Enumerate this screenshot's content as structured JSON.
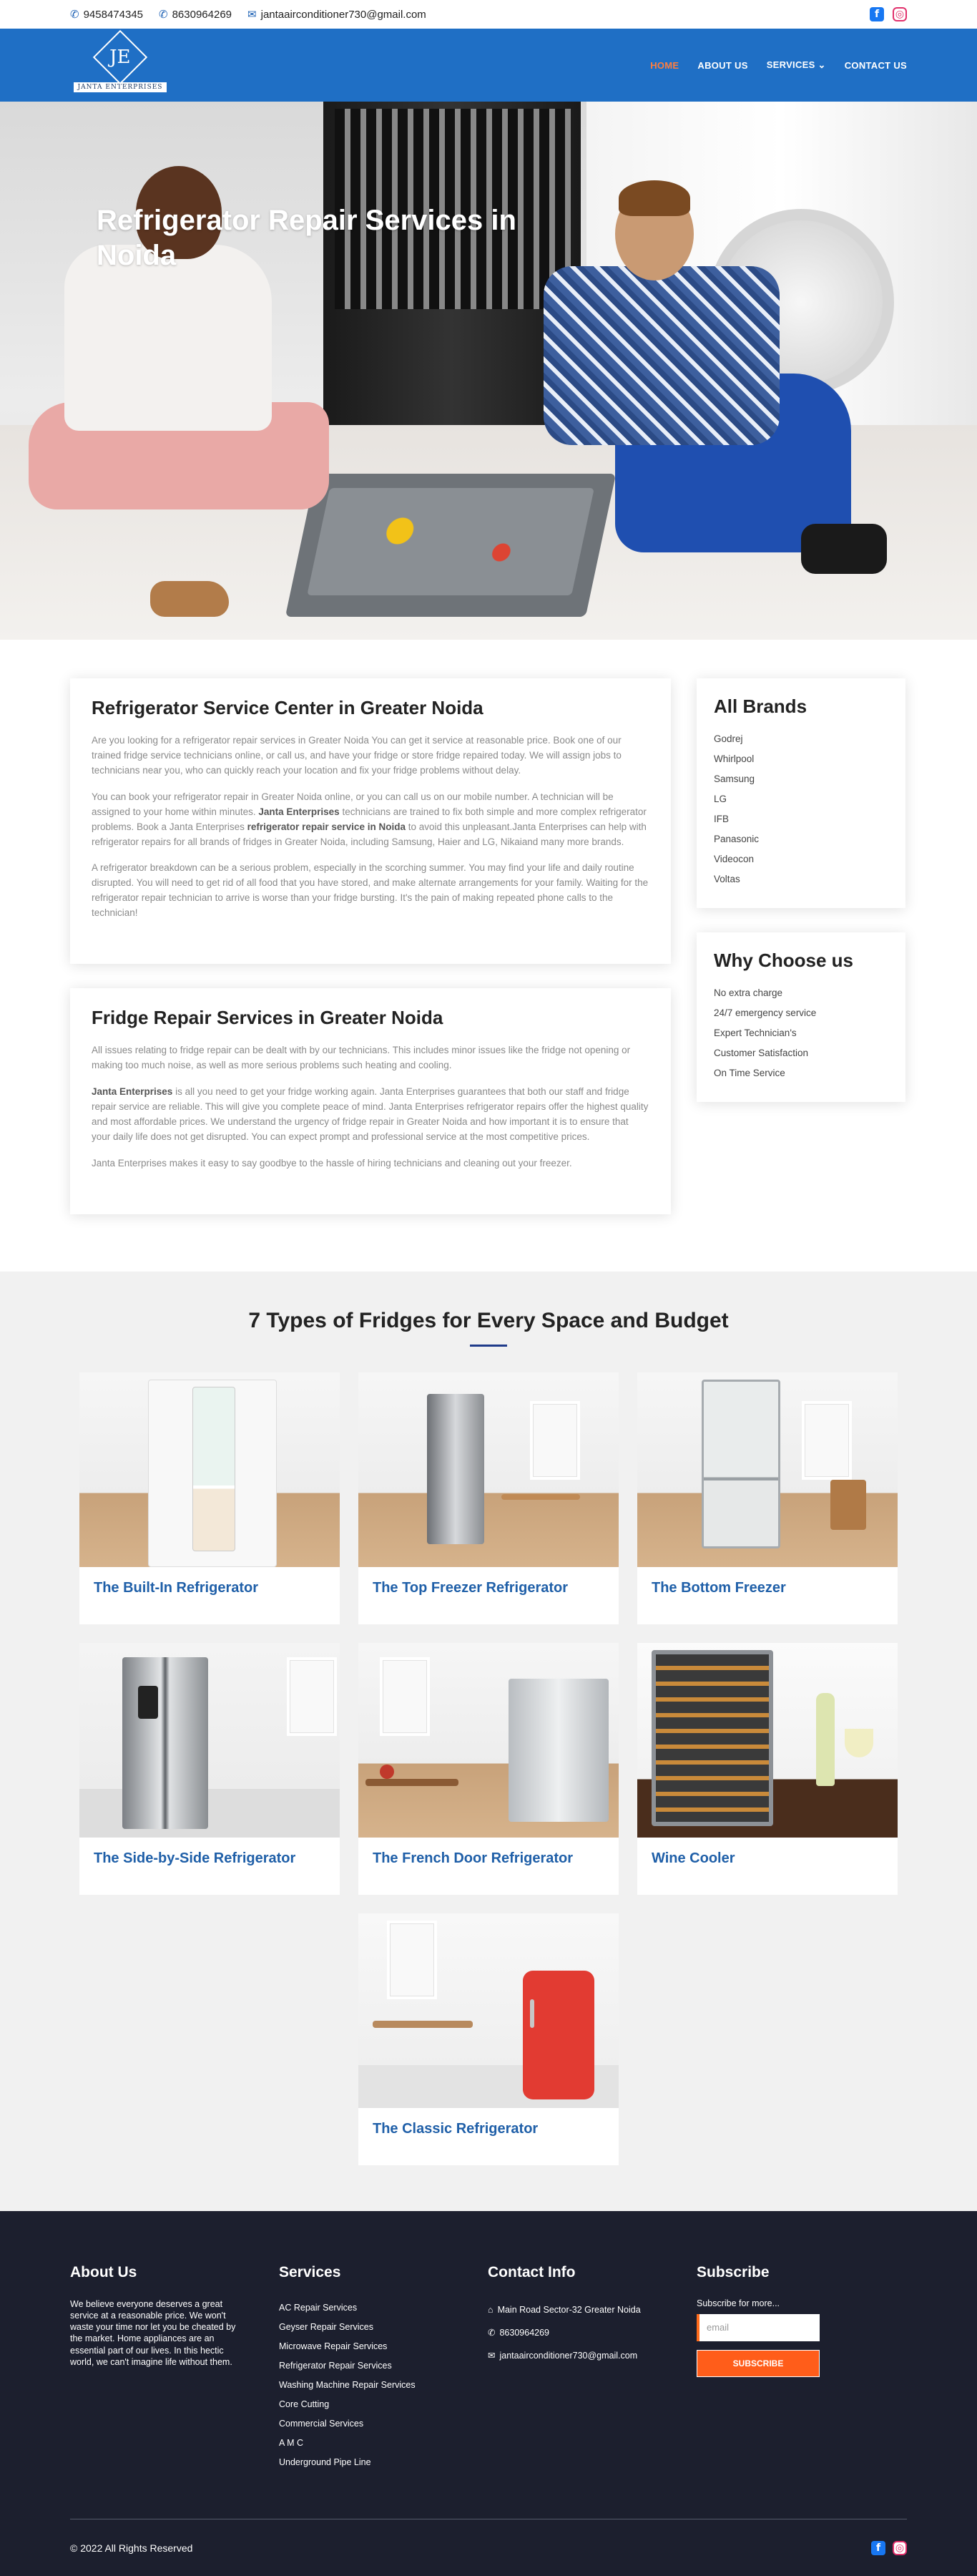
{
  "topbar": {
    "phone1": "9458474345",
    "phone2": "8630964269",
    "email": "jantaairconditioner730@gmail.com"
  },
  "brand": {
    "logo_initials": "JE",
    "logo_name": "JANTA ENTERPRISES"
  },
  "nav": {
    "home": "HOME",
    "about": "ABOUT US",
    "services": "SERVICES",
    "contact": "CONTACT US"
  },
  "hero": {
    "title": "Refrigerator Repair Services in Noida"
  },
  "section1": {
    "title": "Refrigerator Service Center in Greater Noida",
    "p1": "Are you looking for a refrigerator repair services in Greater Noida You can get it service at reasonable price. Book one of our trained fridge service technicians online, or call us, and have your fridge or store fridge repaired today. We will assign jobs to technicians near you, who can quickly reach your location and fix your fridge problems without delay.",
    "p2_a": "You can book your refrigerator repair in Greater Noida online, or you can call us on our mobile number. A technician will be assigned to your home within minutes. ",
    "p2_b": "Janta Enterprises",
    "p2_c": " technicians are trained to fix both simple and more complex refrigerator problems. Book a Janta Enterprises ",
    "p2_d": "refrigerator repair service in Noida",
    "p2_e": " to avoid this unpleasant.Janta Enterprises can help with refrigerator repairs for all brands of fridges in Greater Noida, including Samsung, Haier and LG, Nikaiand many more brands.",
    "p3": "A refrigerator breakdown can be a serious problem, especially in the scorching summer. You may find your life and daily routine disrupted. You will need to get rid of all food that you have stored, and make alternate arrangements for your family. Waiting for the refrigerator repair technician to arrive is worse than your fridge bursting. It's the pain of making repeated phone calls to the technician!"
  },
  "section2": {
    "title": "Fridge Repair Services in Greater Noida",
    "p1": "All issues relating to fridge repair can be dealt with by our technicians. This includes minor issues like the fridge not opening or making too much noise, as well as more serious problems such heating and cooling.",
    "p2_a": "Janta Enterprises",
    "p2_b": " is all you need to get your fridge working again. Janta Enterprises guarantees that both our staff and fridge repair service are reliable. This will give you complete peace of mind. Janta Enterprises refrigerator repairs offer the highest quality and most affordable prices. We understand the urgency of fridge repair in Greater Noida and how important it is to ensure that your daily life does not get disrupted. You can expect prompt and professional service at the most competitive prices.",
    "p3": "Janta Enterprises makes it easy to say goodbye to the hassle of hiring technicians and cleaning out your freezer."
  },
  "brands": {
    "title": "All Brands",
    "items": [
      "Godrej",
      "Whirlpool",
      "Samsung",
      "LG",
      "IFB",
      "Panasonic",
      "Videocon",
      "Voltas"
    ]
  },
  "why": {
    "title": "Why Choose us",
    "items": [
      "No extra charge",
      "24/7 emergency service",
      "Expert Technician's",
      "Customer Satisfaction",
      "On Time Service"
    ]
  },
  "types": {
    "title": "7 Types of Fridges for Every Space and Budget",
    "items": [
      "The Built-In Refrigerator",
      "The Top Freezer Refrigerator",
      "The Bottom Freezer",
      "The Side-by-Side Refrigerator",
      "The French Door Refrigerator",
      "Wine Cooler",
      "The Classic Refrigerator"
    ]
  },
  "footer": {
    "about_title": "About Us",
    "about_text": "We believe everyone deserves a great service at a reasonable price. We won't waste your time nor let you be cheated by the market. Home appliances are an essential part of our lives. In this hectic world, we can't imagine life without them.",
    "services_title": "Services",
    "services": [
      "AC Repair Services",
      "Geyser Repair Services",
      "Microwave Repair Services",
      "Refrigerator Repair Services",
      "Washing Machine Repair Services",
      "Core Cutting",
      "Commercial Services",
      "A M C",
      "Underground Pipe Line"
    ],
    "contact_title": "Contact Info",
    "address": "Main Road Sector-32 Greater Noida",
    "phone": "8630964269",
    "email": "jantaairconditioner730@gmail.com",
    "subscribe_title": "Subscribe",
    "subscribe_text": "Subscribe for more...",
    "email_placeholder": "email",
    "subscribe_button": "SUBSCRIBE",
    "copyright": "© 2022 All Rights Reserved"
  },
  "colors": {
    "nav": "#1f6fc5",
    "accent": "#ff7e3f",
    "footer": "#1c1f2e",
    "type_title": "#1f5fa8"
  }
}
